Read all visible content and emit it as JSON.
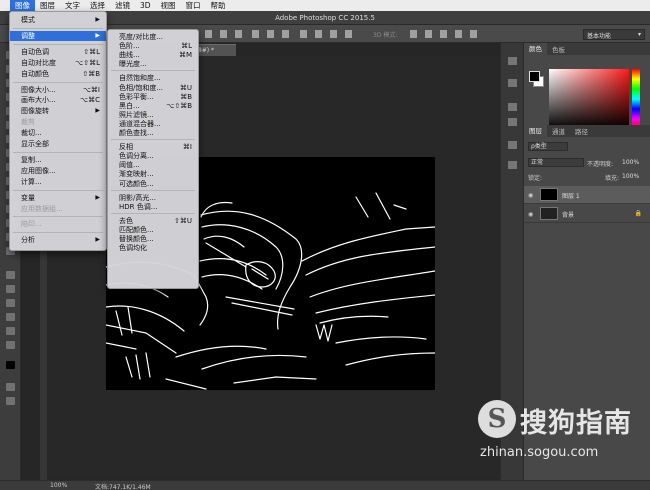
{
  "menubar": [
    "图像",
    "图层",
    "文字",
    "选择",
    "滤镜",
    "3D",
    "视图",
    "窗口",
    "帮助"
  ],
  "window_title": "Adobe Photoshop CC 2015.5",
  "options": {
    "label_3d": "3D 模式:",
    "workspace": "基本功能"
  },
  "doc_tab": "RGB/8#) *",
  "color_panel": {
    "tabs": [
      "颜色",
      "色板"
    ],
    "fg": "#000000",
    "bg": "#ffffff"
  },
  "layers_panel": {
    "tabs": [
      "图层",
      "通道",
      "路径"
    ],
    "filter": "ρ类型",
    "blend_mode": "正常",
    "opacity_label": "不透明度:",
    "opacity": "100%",
    "lock_label": "锁定:",
    "fill_label": "填充:",
    "fill": "100%",
    "layers": [
      {
        "name": "图层 1",
        "locked": false
      },
      {
        "name": "背景",
        "locked": true
      }
    ]
  },
  "status": {
    "zoom": "100%",
    "doc": "文档:747.1K/1.46M"
  },
  "image_menu": [
    {
      "label": "模式",
      "shortcut": "",
      "submenu": true,
      "disabled": false
    },
    {
      "sep": true
    },
    {
      "label": "调整",
      "shortcut": "",
      "submenu": true,
      "disabled": false,
      "highlight": true
    },
    {
      "sep": true
    },
    {
      "label": "自动色调",
      "shortcut": "⇧⌘L",
      "disabled": false
    },
    {
      "label": "自动对比度",
      "shortcut": "⌥⇧⌘L",
      "disabled": false
    },
    {
      "label": "自动颜色",
      "shortcut": "⇧⌘B",
      "disabled": false
    },
    {
      "sep": true
    },
    {
      "label": "图像大小...",
      "shortcut": "⌥⌘I",
      "disabled": false
    },
    {
      "label": "画布大小...",
      "shortcut": "⌥⌘C",
      "disabled": false
    },
    {
      "label": "图像旋转",
      "shortcut": "",
      "submenu": true,
      "disabled": false
    },
    {
      "label": "裁剪",
      "shortcut": "",
      "disabled": true
    },
    {
      "label": "裁切...",
      "shortcut": "",
      "disabled": false
    },
    {
      "label": "显示全部",
      "shortcut": "",
      "disabled": false
    },
    {
      "sep": true
    },
    {
      "label": "复制...",
      "shortcut": "",
      "disabled": false
    },
    {
      "label": "应用图像...",
      "shortcut": "",
      "disabled": false
    },
    {
      "label": "计算...",
      "shortcut": "",
      "disabled": false
    },
    {
      "sep": true
    },
    {
      "label": "变量",
      "shortcut": "",
      "submenu": true,
      "disabled": false
    },
    {
      "label": "应用数据组...",
      "shortcut": "",
      "disabled": true
    },
    {
      "sep": true
    },
    {
      "label": "陷印...",
      "shortcut": "",
      "disabled": true
    },
    {
      "sep": true
    },
    {
      "label": "分析",
      "shortcut": "",
      "submenu": true,
      "disabled": false
    }
  ],
  "adjust_menu": [
    {
      "label": "亮度/对比度...",
      "shortcut": ""
    },
    {
      "label": "色阶...",
      "shortcut": "⌘L"
    },
    {
      "label": "曲线...",
      "shortcut": "⌘M"
    },
    {
      "label": "曝光度...",
      "shortcut": ""
    },
    {
      "sep": true
    },
    {
      "label": "自然饱和度...",
      "shortcut": ""
    },
    {
      "label": "色相/饱和度...",
      "shortcut": "⌘U"
    },
    {
      "label": "色彩平衡...",
      "shortcut": "⌘B"
    },
    {
      "label": "黑白...",
      "shortcut": "⌥⇧⌘B"
    },
    {
      "label": "照片滤镜...",
      "shortcut": ""
    },
    {
      "label": "通道混合器...",
      "shortcut": ""
    },
    {
      "label": "颜色查找...",
      "shortcut": ""
    },
    {
      "sep": true
    },
    {
      "label": "反相",
      "shortcut": "⌘I"
    },
    {
      "label": "色调分离...",
      "shortcut": ""
    },
    {
      "label": "阈值...",
      "shortcut": ""
    },
    {
      "label": "渐变映射...",
      "shortcut": ""
    },
    {
      "label": "可选颜色...",
      "shortcut": ""
    },
    {
      "sep": true
    },
    {
      "label": "阴影/高光...",
      "shortcut": ""
    },
    {
      "label": "HDR 色调...",
      "shortcut": ""
    },
    {
      "sep": true
    },
    {
      "label": "去色",
      "shortcut": "⇧⌘U"
    },
    {
      "label": "匹配颜色...",
      "shortcut": ""
    },
    {
      "label": "替换颜色...",
      "shortcut": ""
    },
    {
      "label": "色调均化",
      "shortcut": ""
    }
  ],
  "watermark": {
    "logo": "S",
    "text": "搜狗指南",
    "url": "zhinan.sogou.com"
  }
}
